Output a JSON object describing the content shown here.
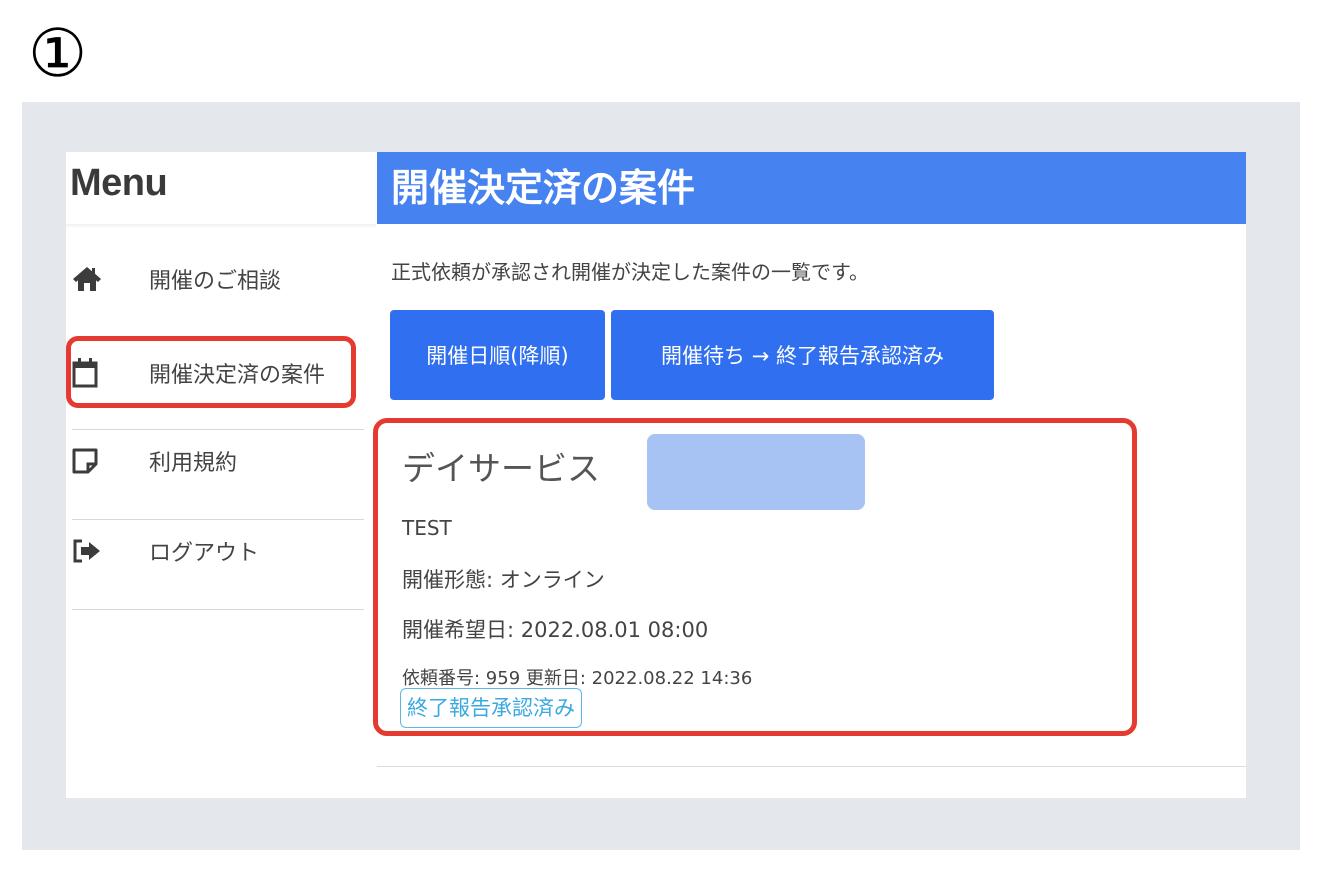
{
  "step_number": "①",
  "sidebar": {
    "title": "Menu",
    "items": [
      {
        "label": "開催のご相談",
        "icon": "home-icon"
      },
      {
        "label": "開催決定済の案件",
        "icon": "calendar-icon"
      },
      {
        "label": "利用規約",
        "icon": "note-icon"
      },
      {
        "label": "ログアウト",
        "icon": "logout-icon"
      }
    ]
  },
  "main": {
    "title": "開催決定済の案件",
    "description": "正式依頼が承認され開催が決定した案件の一覧です。",
    "buttons": [
      "開催日順(降順)",
      "開催待ち → 終了報告承認済み"
    ],
    "card": {
      "title": "デイサービス",
      "name": "TEST",
      "format": "開催形態: オンライン",
      "date": "開催希望日: 2022.08.01 08:00",
      "meta": "依頼番号: 959 更新日: 2022.08.22 14:36",
      "status_badge": "終了報告承認済み"
    }
  },
  "colors": {
    "banner": "#4682f0",
    "button": "#2f6ff0",
    "highlight": "#e53a2f",
    "badge": "#3aa9e2",
    "redaction": "#a7c3f4",
    "frame_bg": "#e4e7ec"
  }
}
